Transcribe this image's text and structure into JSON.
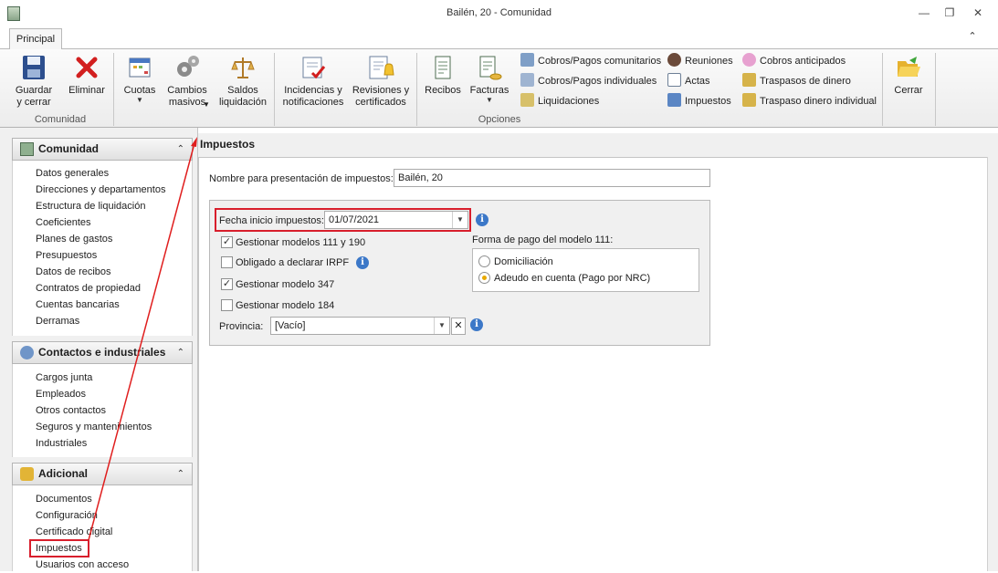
{
  "window": {
    "title": "Bailén, 20 - Comunidad"
  },
  "ribbon": {
    "tab_label": "Principal",
    "group_comunidad": "Comunidad",
    "group_opciones": "Opciones",
    "guardar": "Guardar\ny cerrar",
    "eliminar": "Eliminar",
    "cuotas": "Cuotas",
    "cambios": "Cambios\nmasivos",
    "saldos": "Saldos\nliquidación",
    "incidencias": "Incidencias y\nnotificaciones",
    "revisiones": "Revisiones y\ncertificados",
    "recibos": "Recibos",
    "facturas": "Facturas",
    "cobros_comunitarios": "Cobros/Pagos comunitarios",
    "cobros_individuales": "Cobros/Pagos individuales",
    "liquidaciones": "Liquidaciones",
    "reuniones": "Reuniones",
    "actas": "Actas",
    "impuestos": "Impuestos",
    "cobros_anticipados": "Cobros anticipados",
    "traspasos": "Traspasos de dinero",
    "traspaso_individual": "Traspaso dinero individual",
    "cerrar": "Cerrar"
  },
  "nav": {
    "comunidad": {
      "title": "Comunidad",
      "items": [
        "Datos generales",
        "Direcciones y departamentos",
        "Estructura de liquidación",
        "Coeficientes",
        "Planes de gastos",
        "Presupuestos",
        "Datos de recibos",
        "Contratos de propiedad",
        "Cuentas bancarias",
        "Derramas"
      ]
    },
    "contactos": {
      "title": "Contactos e industriales",
      "items": [
        "Cargos junta",
        "Empleados",
        "Otros contactos",
        "Seguros y manteninientos",
        "Industriales"
      ]
    },
    "adicional": {
      "title": "Adicional",
      "items": [
        "Documentos",
        "Configuración",
        "Certificado digital",
        "Impuestos",
        "Usuarios con acceso"
      ]
    }
  },
  "content": {
    "title": "Impuestos",
    "nombre_label": "Nombre para presentación de impuestos:",
    "nombre_value": "Bailén, 20",
    "fecha_label": "Fecha inicio impuestos:",
    "fecha_value": "01/07/2021",
    "chk_111_190": "Gestionar modelos 111 y 190",
    "chk_irpf": "Obligado a declarar IRPF",
    "chk_347": "Gestionar modelo 347",
    "chk_184": "Gestionar modelo 184",
    "provincia_label": "Provincia:",
    "provincia_value": "[Vacío]",
    "forma_pago_label": "Forma de pago del modelo 111:",
    "radio_domiciliacion": "Domiciliación",
    "radio_adeudo": "Adeudo en cuenta (Pago por NRC)"
  }
}
